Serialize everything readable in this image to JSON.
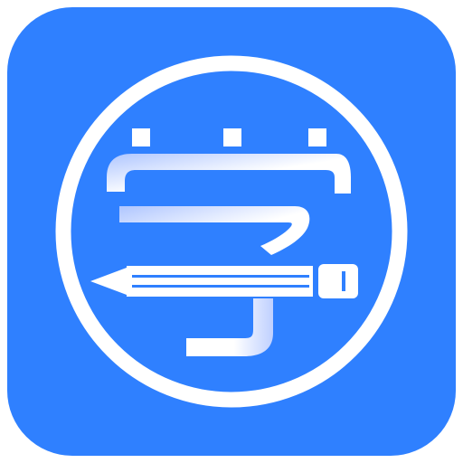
{
  "icon": {
    "semantic": "learning-app-icon",
    "glyph": "学",
    "motif": "pencil",
    "colors": {
      "background": "#2F80FF",
      "ring": "#FFFFFF",
      "glyph": "#FFFFFF",
      "glyph_shade": "#C9D7FF",
      "pencil_lines": "#2F80FF"
    }
  }
}
